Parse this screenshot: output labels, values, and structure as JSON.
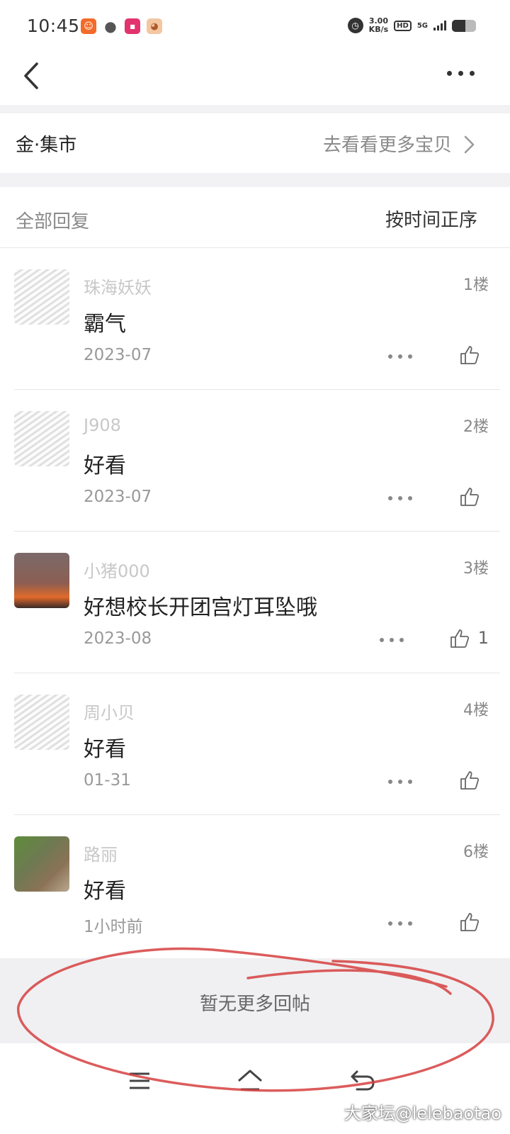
{
  "status_bar": {
    "time": "10:45",
    "net_speed_value": "3.00",
    "net_speed_unit": "KB/s",
    "hd_label": "HD",
    "network_label": "5G",
    "battery_level": 0.55
  },
  "header": {
    "back_icon": "chevron-left-icon",
    "more_icon": "more-horizontal-icon"
  },
  "market": {
    "title": "金·集市",
    "link_label": "去看看更多宝贝"
  },
  "filter": {
    "all_label": "全部回复",
    "sort_label": "按时间正序"
  },
  "replies": [
    {
      "nickname": "珠海妖妖",
      "floor": "1楼",
      "content": "霸气",
      "date": "2023-07",
      "likes": ""
    },
    {
      "nickname": "J908",
      "floor": "2楼",
      "content": "好看",
      "date": "2023-07",
      "likes": ""
    },
    {
      "nickname": "小猪000",
      "floor": "3楼",
      "content": "好想校长开团宫灯耳坠哦",
      "date": "2023-08",
      "likes": "1"
    },
    {
      "nickname": "周小贝",
      "floor": "4楼",
      "content": "好看",
      "date": "01-31",
      "likes": ""
    },
    {
      "nickname": "路丽",
      "floor": "6楼",
      "content": "好看",
      "date": "1小时前",
      "likes": ""
    }
  ],
  "footer": {
    "end_text": "暂无更多回帖"
  },
  "watermark": "大家坛@lelebaotao",
  "colors": {
    "annotation_red": "#d6403f",
    "separator": "#f2f2f4"
  }
}
